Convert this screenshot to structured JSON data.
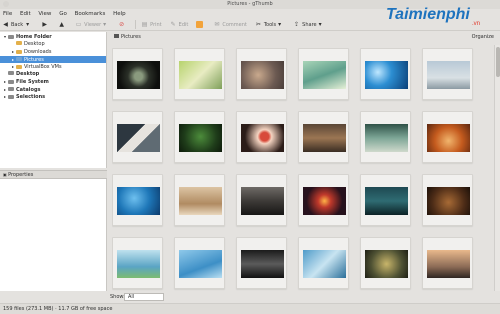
{
  "window": {
    "title": "Pictures - gThumb"
  },
  "logo": {
    "text": "Taimienphi",
    "suffix": ".vn"
  },
  "menu": [
    "File",
    "Edit",
    "View",
    "Go",
    "Bookmarks",
    "Help"
  ],
  "toolbar": {
    "back": "Back",
    "viewer": "Viewer",
    "print": "Print",
    "edit": "Edit",
    "comment": "Comment",
    "tools": "Tools",
    "share": "Share"
  },
  "tree": [
    {
      "label": "Home Folder",
      "level": 0,
      "bold": true,
      "expand": "▾",
      "icon": "home-folder-icon"
    },
    {
      "label": "Desktop",
      "level": 1,
      "bold": false,
      "expand": "",
      "icon": "folder-icon"
    },
    {
      "label": "Downloads",
      "level": 1,
      "bold": false,
      "expand": "▸",
      "icon": "folder-icon"
    },
    {
      "label": "Pictures",
      "level": 1,
      "bold": false,
      "expand": "▸",
      "icon": "folder-icon",
      "selected": true
    },
    {
      "label": "VirtualBox VMs",
      "level": 1,
      "bold": false,
      "expand": "▸",
      "icon": "folder-icon"
    },
    {
      "label": "Desktop",
      "level": 0,
      "bold": true,
      "expand": "",
      "icon": "desktop-icon"
    },
    {
      "label": "File System",
      "level": 0,
      "bold": true,
      "expand": "▸",
      "icon": "drive-icon"
    },
    {
      "label": "Catalogs",
      "level": 0,
      "bold": true,
      "expand": "▸",
      "icon": "catalog-icon"
    },
    {
      "label": "Selections",
      "level": 0,
      "bold": true,
      "expand": "▸",
      "icon": "star-icon"
    }
  ],
  "properties": {
    "title": "Properties"
  },
  "main": {
    "location": "Pictures",
    "organize": "Organize"
  },
  "filter": {
    "label": "Show:",
    "value": "All"
  },
  "status": {
    "text": "159 files (273.1 MB) · 11.7 GB of free space"
  },
  "colors": {
    "selection": "#4a90d9",
    "window_bg": "#e4e2df"
  }
}
